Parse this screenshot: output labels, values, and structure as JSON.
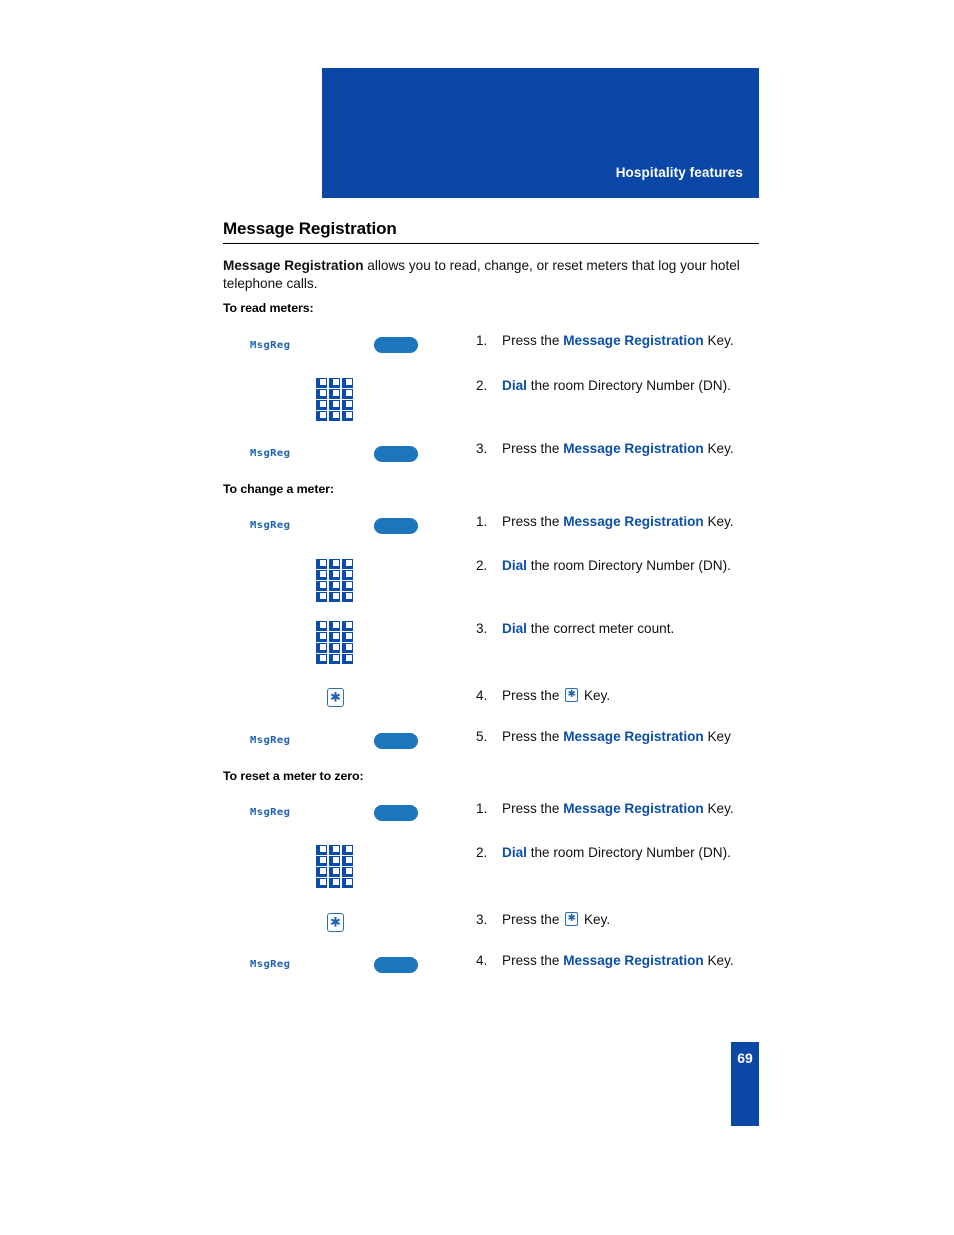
{
  "header": {
    "title": "Hospitality features",
    "banner_color": "#0A47A6"
  },
  "page": {
    "heading": "Message Registration",
    "number": "69",
    "accent_color": "#0B4FA8",
    "softkey_color": "#1B76BC",
    "lcd_text_color": "#1C62B0"
  },
  "intro": {
    "bold_lead": "Message Registration",
    "rest": " allows you to read, change, or reset meters that log your hotel telephone calls."
  },
  "sections": [
    {
      "title": "To read meters:",
      "steps": [
        {
          "num": "1.",
          "pre": "Press the ",
          "highlight": "Message Registration",
          "post": " Key.",
          "icon": "softkey",
          "lcd_label": "MsgReg"
        },
        {
          "num": "2.",
          "pre": "",
          "highlight": "Dial",
          "post": " the room Directory Number (DN).",
          "icon": "keypad",
          "lcd_label": ""
        },
        {
          "num": "3.",
          "pre": "Press the ",
          "highlight": "Message Registration",
          "post": " Key.",
          "icon": "softkey",
          "lcd_label": "MsgReg"
        }
      ]
    },
    {
      "title": "To change a meter:",
      "steps": [
        {
          "num": "1.",
          "pre": "Press the ",
          "highlight": "Message Registration",
          "post": " Key.",
          "icon": "softkey",
          "lcd_label": "MsgReg"
        },
        {
          "num": "2.",
          "pre": "",
          "highlight": "Dial",
          "post": " the room Directory Number (DN).",
          "icon": "keypad",
          "lcd_label": ""
        },
        {
          "num": "3.",
          "pre": "",
          "highlight": "Dial",
          "post": " the correct meter count.",
          "icon": "keypad",
          "lcd_label": ""
        },
        {
          "num": "4.",
          "pre": "Press the ",
          "highlight": "",
          "post": " Key.",
          "icon": "starkey",
          "inline_star": true,
          "lcd_label": ""
        },
        {
          "num": "5.",
          "pre": "Press the ",
          "highlight": "Message Registration",
          "post": " Key",
          "icon": "softkey",
          "lcd_label": "MsgReg"
        }
      ]
    },
    {
      "title": "To reset a meter to zero:",
      "steps": [
        {
          "num": "1.",
          "pre": "Press the ",
          "highlight": "Message Registration",
          "post": " Key.",
          "icon": "softkey",
          "lcd_label": "MsgReg"
        },
        {
          "num": "2.",
          "pre": "",
          "highlight": "Dial",
          "post": " the room Directory Number (DN).",
          "icon": "keypad",
          "lcd_label": ""
        },
        {
          "num": "3.",
          "pre": "Press the ",
          "highlight": "",
          "post": " Key.",
          "icon": "starkey",
          "inline_star": true,
          "lcd_label": ""
        },
        {
          "num": "4.",
          "pre": "Press the ",
          "highlight": "Message Registration",
          "post": " Key.",
          "icon": "softkey",
          "lcd_label": "MsgReg"
        }
      ]
    }
  ],
  "icons": {
    "star_glyph": "✱",
    "keypad_name": "dialpad-icon",
    "softkey_name": "softkey-button-icon"
  }
}
